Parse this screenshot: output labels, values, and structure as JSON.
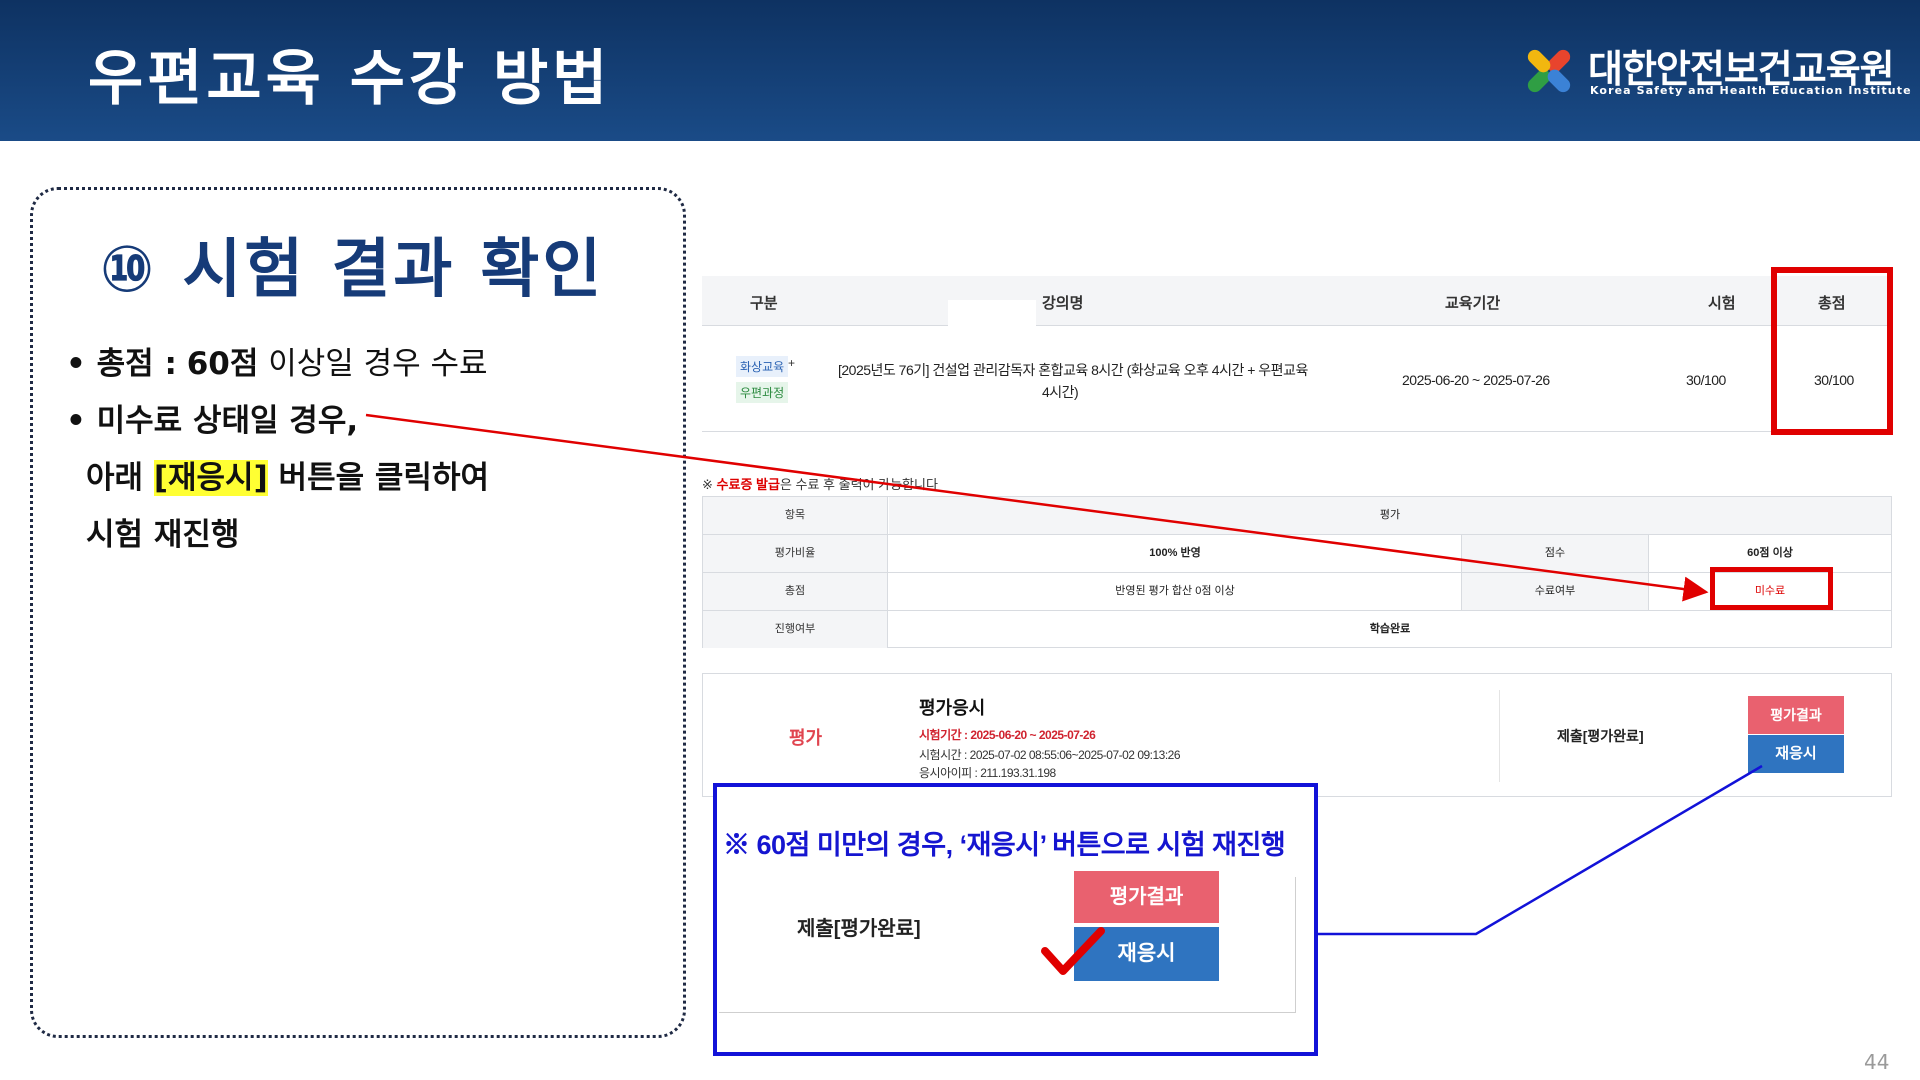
{
  "header": {
    "title": "우편교육 수강 방법",
    "logo_name_ko": "대한안전보건교육원",
    "logo_name_en": "Korea Safety and Health Education Institute"
  },
  "left": {
    "step_title": "⑩ 시험 결과 확인",
    "bullet1_label": "• 총점 :",
    "bullet1_score": "60점",
    "bullet1_rest": "이상일 경우 수료",
    "bullet2": "• 미수료 상태일 경우,",
    "line3_pre": "아래",
    "line3_hl": "[재응시]",
    "line3_post": "버튼을 클릭하여",
    "line4": "시험 재진행"
  },
  "course_table": {
    "headers": [
      "구분",
      "강의명",
      "교육기간",
      "시험",
      "총점"
    ],
    "tag_a": "화상교육",
    "tag_plus": "+",
    "tag_b": "우편과정",
    "course_line1": "[2025년도 76기] 건설업 관리감독자 혼합교육 8시간 (화상교육 오후 4시간 + 우편교육",
    "course_line2": "4시간)",
    "period": "2025-06-20 ~ 2025-07-26",
    "exam": "30/100",
    "total": "30/100"
  },
  "notice": {
    "mark": "※",
    "red": "수료증 발급",
    "rest": "은 수료 후 출력이 가능합니다"
  },
  "summary": {
    "header_label": "항목",
    "header_value": "평가",
    "r1_label": "평가비율",
    "r1_value": "100% 반영",
    "r1_k": "점수",
    "r1_v": "60점 이상",
    "r2_label": "총점",
    "r2_value": "반영된 평가 합산 0점 이상",
    "r2_k": "수료여부",
    "r2_v": "미수료",
    "r3_label": "진행여부",
    "r3_value": "학습완료"
  },
  "evaluation": {
    "label": "평가",
    "title": "평가응시",
    "period": "시험기간 : 2025-06-20 ~ 2025-07-26",
    "time": "시험시간 : 2025-07-02 08:55:06~2025-07-02 09:13:26",
    "ip": "응시아이피 : 211.193.31.198",
    "submit": "제출[평가완료]",
    "result_button": "평가결과",
    "retake_button": "재응시"
  },
  "callout": {
    "text": "※ 60점 미만의 경우, ‘재응시’ 버튼으로 시험 재진행",
    "submit": "제출[평가완료]",
    "result_button": "평가결과",
    "retake_button": "재응시"
  },
  "page_number": "44",
  "colors": {
    "header_bg": "#0e3262",
    "title_blue": "#163b78",
    "red_highlight": "#e00000",
    "callout_blue": "#1212d8",
    "btn_pink": "#e9616f",
    "btn_blue": "#2f74c0",
    "yellow_highlight": "#ffff33"
  }
}
